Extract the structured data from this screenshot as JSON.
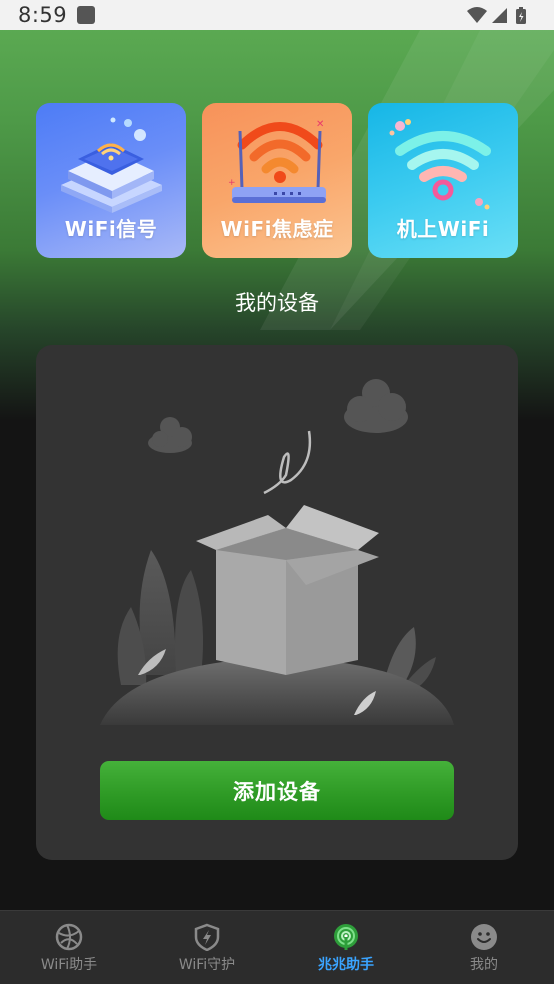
{
  "status_bar": {
    "time": "8:59"
  },
  "quick_cards": [
    {
      "label": "WiFi信号",
      "icon": "wifi-server-icon",
      "color": "#4d7cf6"
    },
    {
      "label": "WiFi焦虑症",
      "icon": "wifi-router-icon",
      "color": "#f7925a"
    },
    {
      "label": "机上WiFi",
      "icon": "wifi-signal-icon",
      "color": "#16b6e6"
    }
  ],
  "devices": {
    "title": "我的设备",
    "add_button_label": "添加设备"
  },
  "bottom_nav": {
    "items": [
      {
        "label": "WiFi助手",
        "icon": "globe-icon",
        "active": false
      },
      {
        "label": "WiFi守护",
        "icon": "shield-bolt-icon",
        "active": false
      },
      {
        "label": "兆兆助手",
        "icon": "broadcast-icon",
        "active": true
      },
      {
        "label": "我的",
        "icon": "smiley-icon",
        "active": false
      }
    ],
    "active_color": "#3aa4ff",
    "inactive_color": "#8a8a8a"
  }
}
